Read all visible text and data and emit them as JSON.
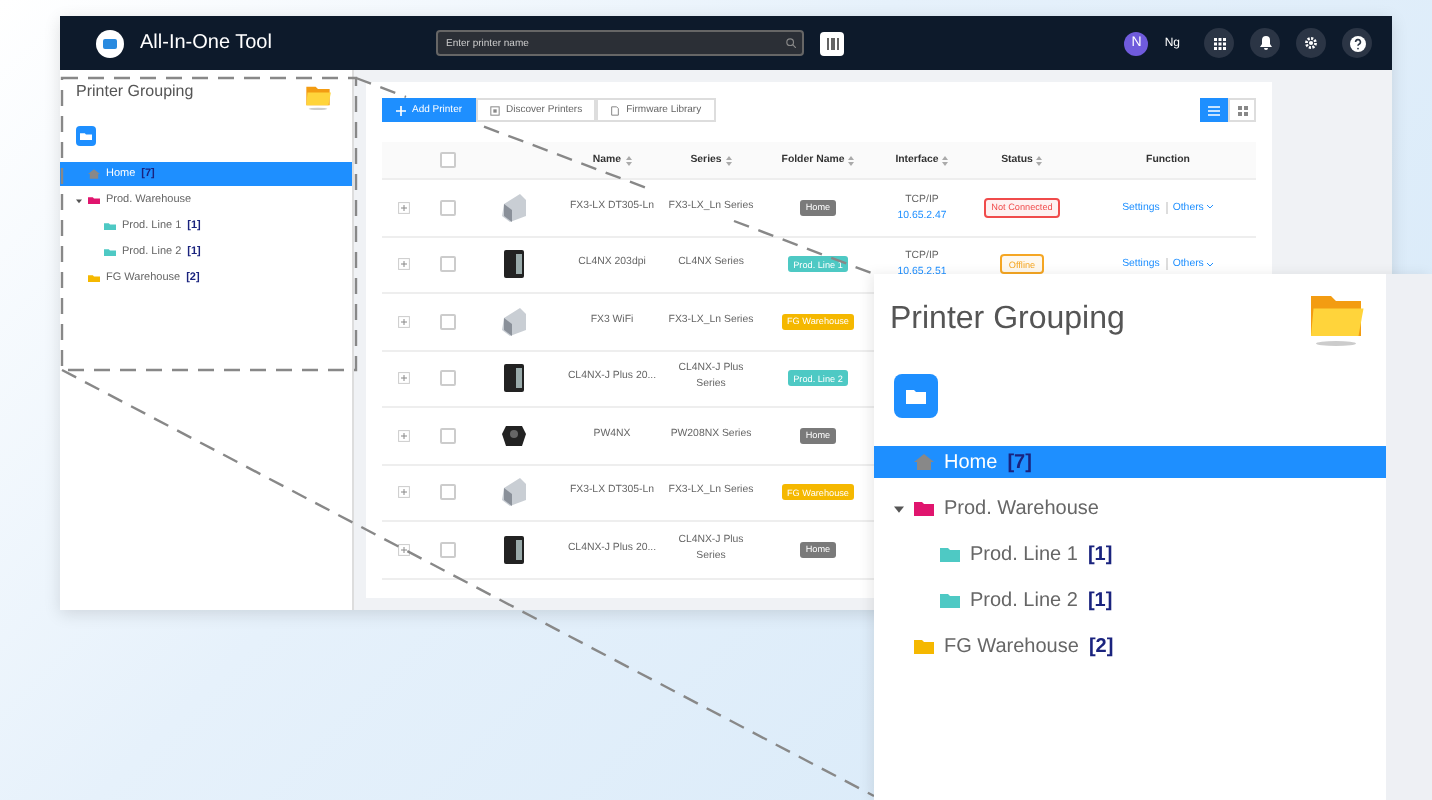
{
  "header": {
    "app_name": "All-In-One Tool",
    "search": {
      "placeholder": "Enter printer name"
    },
    "user": {
      "initial": "N",
      "name": "Ng"
    }
  },
  "sidebar": {
    "title": "Printer Grouping",
    "tree": [
      {
        "kind": "home",
        "label": "Home",
        "count": "[7]",
        "selected": true
      },
      {
        "kind": "folder",
        "label": "Prod. Warehouse",
        "color": "#e0156e",
        "selected": false,
        "expanded": true,
        "children": [
          {
            "kind": "folder",
            "label": "Prod. Line 1",
            "count": "[1]",
            "color": "#4ec9c4",
            "selected": false
          },
          {
            "kind": "folder",
            "label": "Prod. Line 2",
            "count": "[1]",
            "color": "#4ec9c4",
            "selected": false
          }
        ]
      },
      {
        "kind": "folder",
        "label": "FG Warehouse",
        "count": "[2]",
        "color": "#f5b800",
        "selected": false
      }
    ]
  },
  "toolbar": {
    "buttons": [
      {
        "kind": "primary",
        "label": "Add Printer"
      },
      {
        "kind": "discover",
        "label": "Discover Printers"
      },
      {
        "kind": "firmware",
        "label": "Firmware Library"
      }
    ],
    "views": [
      {
        "kind": "list",
        "selected": true
      },
      {
        "kind": "grid",
        "selected": false
      }
    ]
  },
  "table": {
    "select_all_checked": false,
    "columns": [
      "Name",
      "Series",
      "Folder Name",
      "Interface",
      "Status",
      "Function"
    ],
    "rows": [
      {
        "kind": "desktop",
        "checked": false,
        "name": "FX3-LX DT305-Ln",
        "series": "FX3-LX_Ln Series",
        "folder": {
          "label": "Home",
          "color": "#7a7a7a"
        },
        "interface": {
          "type": "TCP/IP",
          "address": "10.65.2.47"
        },
        "status": {
          "label": "Not Connected",
          "color": "#f04b4b"
        },
        "actions": [
          "Settings",
          "Others"
        ]
      },
      {
        "kind": "industrial",
        "checked": false,
        "name": "CL4NX 203dpi",
        "series": "CL4NX Series",
        "folder": {
          "label": "Prod. Line 1",
          "color": "#4ec9c4"
        },
        "interface": {
          "type": "TCP/IP",
          "address": "10.65.2.51"
        },
        "status": {
          "label": "Offline",
          "color": "#f5a623"
        },
        "actions": [
          "Settings",
          "Others"
        ]
      },
      {
        "kind": "desktop",
        "checked": false,
        "name": "FX3 WiFi",
        "series": "FX3-LX_Ln Series",
        "folder": {
          "label": "FG Warehouse",
          "color": "#f5b800"
        }
      },
      {
        "kind": "industrial",
        "checked": false,
        "name": "CL4NX-J Plus 20...",
        "series": "CL4NX-J Plus Series",
        "folder": {
          "label": "Prod. Line 2",
          "color": "#4ec9c4"
        }
      },
      {
        "kind": "mobile",
        "checked": false,
        "name": "PW4NX",
        "series": "PW208NX Series",
        "folder": {
          "label": "Home",
          "color": "#7a7a7a"
        }
      },
      {
        "kind": "desktop",
        "checked": false,
        "name": "FX3-LX DT305-Ln",
        "series": "FX3-LX_Ln Series",
        "folder": {
          "label": "FG Warehouse",
          "color": "#f5b800"
        }
      },
      {
        "kind": "industrial",
        "checked": false,
        "name": "CL4NX-J Plus 20...",
        "series": "CL4NX-J Plus Series",
        "folder": {
          "label": "Home",
          "color": "#7a7a7a"
        }
      }
    ]
  },
  "zoom_inset": {
    "title": "Printer Grouping",
    "tree": [
      {
        "kind": "home",
        "label": "Home",
        "count": "[7]",
        "selected": true
      },
      {
        "kind": "folder",
        "label": "Prod. Warehouse",
        "color": "#e0156e",
        "selected": false,
        "expanded": true,
        "children": [
          {
            "kind": "folder",
            "label": "Prod. Line 1",
            "count": "[1]",
            "color": "#4ec9c4",
            "selected": false
          },
          {
            "kind": "folder",
            "label": "Prod. Line 2",
            "count": "[1]",
            "color": "#4ec9c4",
            "selected": false
          }
        ]
      },
      {
        "kind": "folder",
        "label": "FG Warehouse",
        "count": "[2]",
        "color": "#f5b800",
        "selected": false
      }
    ]
  }
}
